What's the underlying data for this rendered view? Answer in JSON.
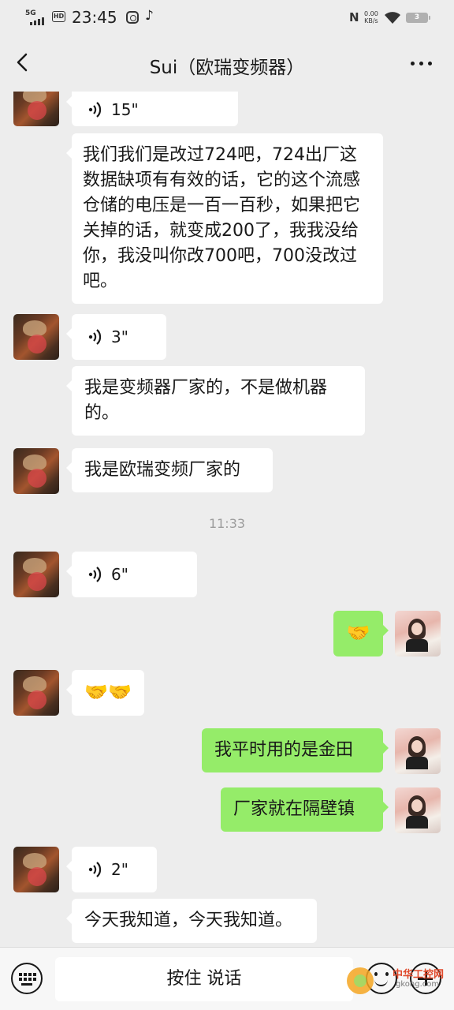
{
  "status_bar": {
    "network": "5G",
    "hd": "HD",
    "time": "23:45",
    "nfc": "N",
    "speed_value": "0.00",
    "speed_unit": "KB/s",
    "battery": "3"
  },
  "nav": {
    "title": "Sui（欧瑞变频器）"
  },
  "messages": [
    {
      "side": "left",
      "type": "voice",
      "duration": "15\""
    },
    {
      "side": "left",
      "type": "text",
      "text": "我们我们是改过724吧，724出厂这数据缺项有有效的话，它的这个流感仓储的电压是一百一百秒，如果把它关掉的话，就变成200了，我我没给你，我没叫你改700吧，700没改过吧。"
    },
    {
      "side": "left",
      "type": "voice",
      "duration": "3\""
    },
    {
      "side": "left",
      "type": "text",
      "text": "我是变频器厂家的，不是做机器的。"
    },
    {
      "side": "left",
      "type": "text",
      "text": "我是欧瑞变频厂家的"
    },
    {
      "side": "left",
      "type": "voice",
      "duration": "6\""
    },
    {
      "side": "right",
      "type": "emoji",
      "text": "🤝"
    },
    {
      "side": "left",
      "type": "emoji",
      "text": "🤝🤝"
    },
    {
      "side": "right",
      "type": "text",
      "text": "我平时用的是金田"
    },
    {
      "side": "right",
      "type": "text",
      "text": "厂家就在隔壁镇"
    },
    {
      "side": "left",
      "type": "voice",
      "duration": "2\""
    },
    {
      "side": "left",
      "type": "text",
      "text": "今天我知道，今天我知道。"
    }
  ],
  "timestamp": "11:33",
  "input": {
    "hold_to_talk": "按住 说话"
  },
  "watermark": {
    "text": "中华工控网",
    "sub": "gkong.com"
  },
  "colors": {
    "background": "#ededed",
    "bubble_self": "#95ec69",
    "bubble_other": "#ffffff"
  }
}
